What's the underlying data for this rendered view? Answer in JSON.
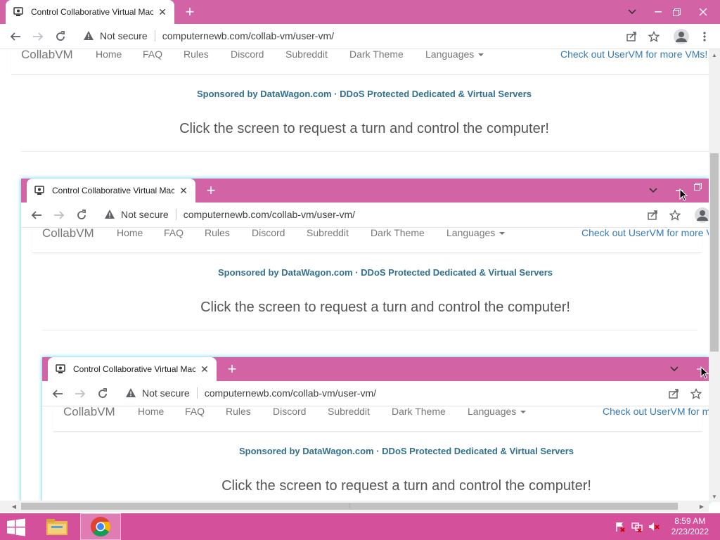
{
  "browser": {
    "tab_title": "Control Collaborative Virtual Mac",
    "security_label": "Not secure",
    "url_host": "computernewb.com",
    "url_path": "/collab-vm/user-vm/"
  },
  "site": {
    "brand": "CollabVM",
    "nav": [
      "Home",
      "FAQ",
      "Rules",
      "Discord",
      "Subreddit",
      "Dark Theme"
    ],
    "languages": "Languages",
    "check_out": "Check out UserVM for more VMs!",
    "check_out_l2": "Check out UserVM for more V",
    "check_out_l3": "Check out UserVM for m",
    "sponsor": "Sponsored by DataWagon.com · DDoS Protected Dedicated & Virtual Servers",
    "prompt": "Click the screen to request a turn and control the computer!"
  },
  "taskbar": {
    "time": "8:59 AM",
    "date": "2/23/2022"
  },
  "colors": {
    "tabstrip": "#d264a5",
    "taskbar": "#d5509b",
    "link": "#337ab7",
    "sponsor": "#31708f"
  }
}
